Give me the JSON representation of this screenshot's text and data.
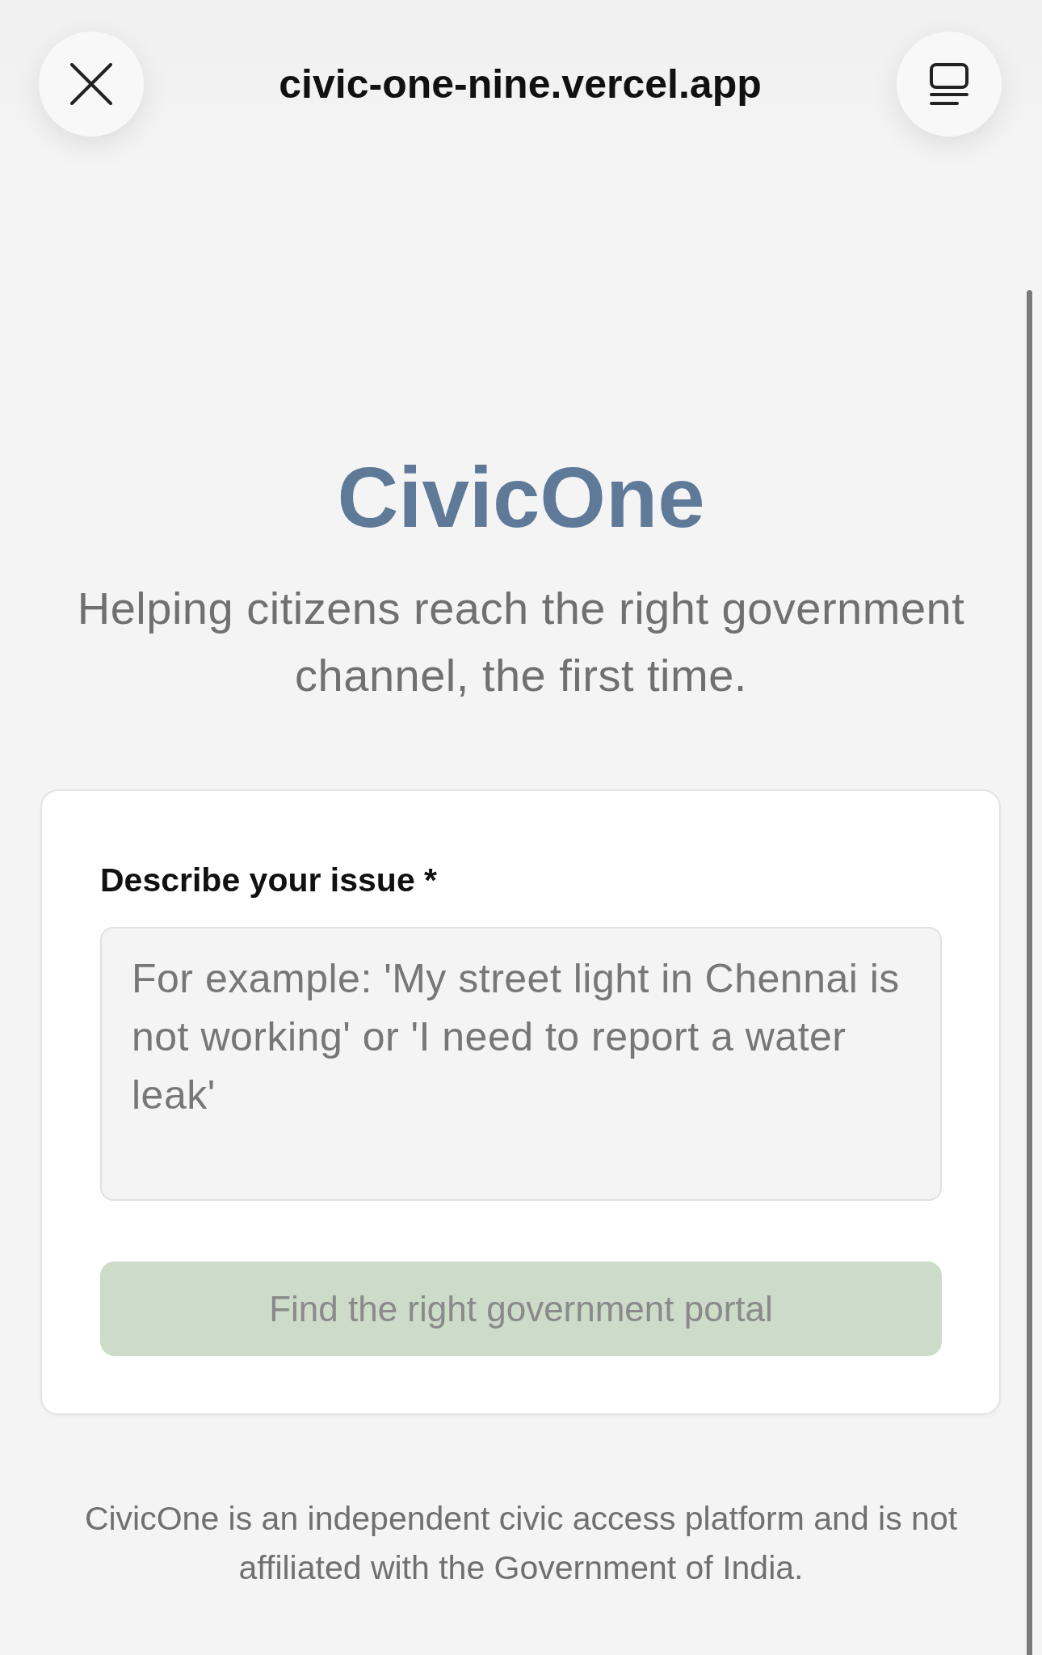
{
  "browser_bar": {
    "url": "civic-one-nine.vercel.app"
  },
  "header": {
    "title": "CivicOne",
    "tagline": "Helping citizens reach the right government channel, the first time."
  },
  "form": {
    "label": "Describe your issue *",
    "issue_field": {
      "placeholder": "For example: 'My street light in Chennai is not working' or 'I need to report a water leak'"
    },
    "submit_button": {
      "label": "Find the right government portal",
      "disabled": true
    }
  },
  "footer": {
    "disclaimer": "CivicOne is an independent civic access platform and is not affiliated with the Government of India."
  }
}
